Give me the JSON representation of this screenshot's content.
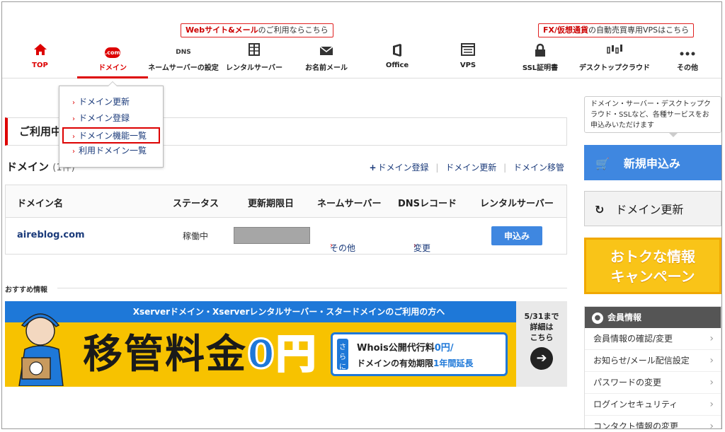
{
  "promos": {
    "left": {
      "red": "Webサイト&メール",
      "black": "のご利用ならこちら"
    },
    "right": {
      "red": "FX/仮想通貨",
      "black": "の自動売買専用VPSはこちら"
    }
  },
  "nav": [
    {
      "label": "TOP",
      "icon": "home-icon"
    },
    {
      "label": "ドメイン",
      "icon": "com-icon",
      "badge": ".com"
    },
    {
      "label": "ネームサーバーの設定",
      "icon": "dns-icon",
      "badge": "DNS"
    },
    {
      "label": "レンタルサーバー",
      "icon": "server-icon"
    },
    {
      "label": "お名前メール",
      "icon": "mail-icon"
    },
    {
      "label": "Office",
      "icon": "office-icon"
    },
    {
      "label": "VPS",
      "icon": "vps-icon"
    },
    {
      "label": "SSL証明書",
      "icon": "lock-icon"
    },
    {
      "label": "デスクトップクラウド",
      "icon": "chart-icon"
    },
    {
      "label": "その他",
      "icon": "more-icon"
    }
  ],
  "dropdown": [
    "ドメイン更新",
    "ドメイン登録",
    "ドメイン機能一覧",
    "利用ドメイン一覧"
  ],
  "notice": {
    "title": "ご利用中"
  },
  "domain_section": {
    "title": "ドメイン",
    "count": "(1件)",
    "links": {
      "register": "ドメイン登録",
      "renew": "ドメイン更新",
      "transfer": "ドメイン移管"
    }
  },
  "table": {
    "headers": [
      "ドメイン名",
      "ステータス",
      "更新期限日",
      "ネームサーバー",
      "DNSレコード",
      "レンタルサーバー"
    ],
    "row": {
      "domain": "aireblog.com",
      "status": "稼働中",
      "nameserver": "その他",
      "dns": "変更",
      "rental": "申込み"
    }
  },
  "recommend": {
    "title": "おすすめ情報",
    "banner": {
      "strip": "Xserverドメイン・Xserverレンタルサーバー・スタードメインのご利用の方へ",
      "big": "移管料金",
      "zero": "0円",
      "tag": "さらに",
      "line1a": "Whois公開代行料",
      "line1b": "0円",
      "line1c": "/",
      "line2a": "ドメインの有効期限",
      "line2b": "1年間延長",
      "side1": "5/31まで",
      "side2": "詳細は",
      "side3": "こちら"
    }
  },
  "sidebar": {
    "bubble": "ドメイン・サーバー・デスクトップクラウド・SSLなど、各種サービスをお申込みいただけます",
    "new_button": "新規申込み",
    "renew_button": "ドメイン更新",
    "campaign1": "おトクな情報",
    "campaign2": "キャンペーン",
    "member_title": "会員情報",
    "member_items": [
      "会員情報の確認/変更",
      "お知らせ/メール配信設定",
      "パスワードの変更",
      "ログインセキュリティ",
      "コンタクト情報の変更"
    ]
  }
}
